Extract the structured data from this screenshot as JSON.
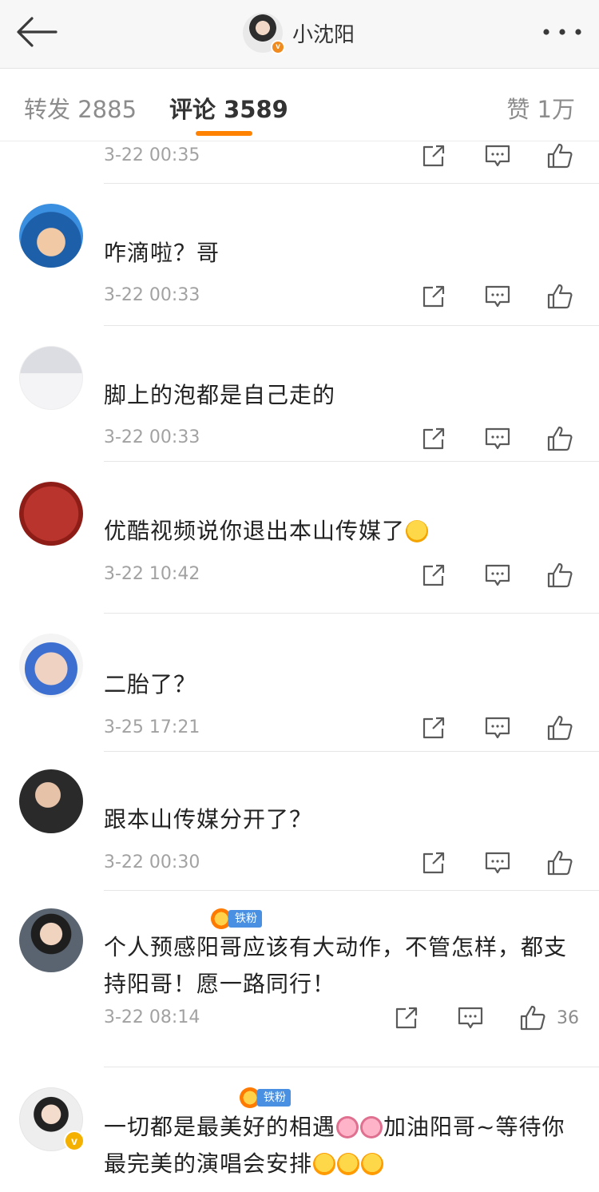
{
  "header": {
    "title": "小沈阳",
    "verified_badge": "v"
  },
  "tabs": {
    "repost": "转发 2885",
    "comment": "评论 3589",
    "like": "赞 1万"
  },
  "comments": [
    {
      "time": "3-22 00:35"
    },
    {
      "text": "咋滴啦？哥",
      "time": "3-22 00:33"
    },
    {
      "text": "脚上的泡都是自己走的",
      "time": "3-22 00:33"
    },
    {
      "text": "优酷视频说你退出本山传媒了",
      "time": "3-22 10:42",
      "emoji": "laugh"
    },
    {
      "text": "二胎了？",
      "time": "3-25 17:21"
    },
    {
      "text": "跟本山传媒分开了？",
      "time": "3-22 00:30"
    },
    {
      "badge": "铁粉",
      "text": "个人预感阳哥应该有大动作，不管怎样，都支持阳哥！愿一路同行！",
      "time": "3-22 08:14",
      "like_count": "36"
    },
    {
      "badge": "铁粉",
      "text_a": "一切都是最美好的相遇",
      "text_b": "加油阳哥~等待你最完美的演唱会安排"
    }
  ],
  "icons": {
    "back": "back-arrow-icon",
    "more": "more-icon",
    "repost": "share-icon",
    "comment": "comment-icon",
    "like": "thumbs-up-icon"
  },
  "colors": {
    "accent": "#ff8200",
    "fan_badge": "#4a90e2",
    "verified": "#f08b1f",
    "timestamp": "#a2a2a2"
  }
}
